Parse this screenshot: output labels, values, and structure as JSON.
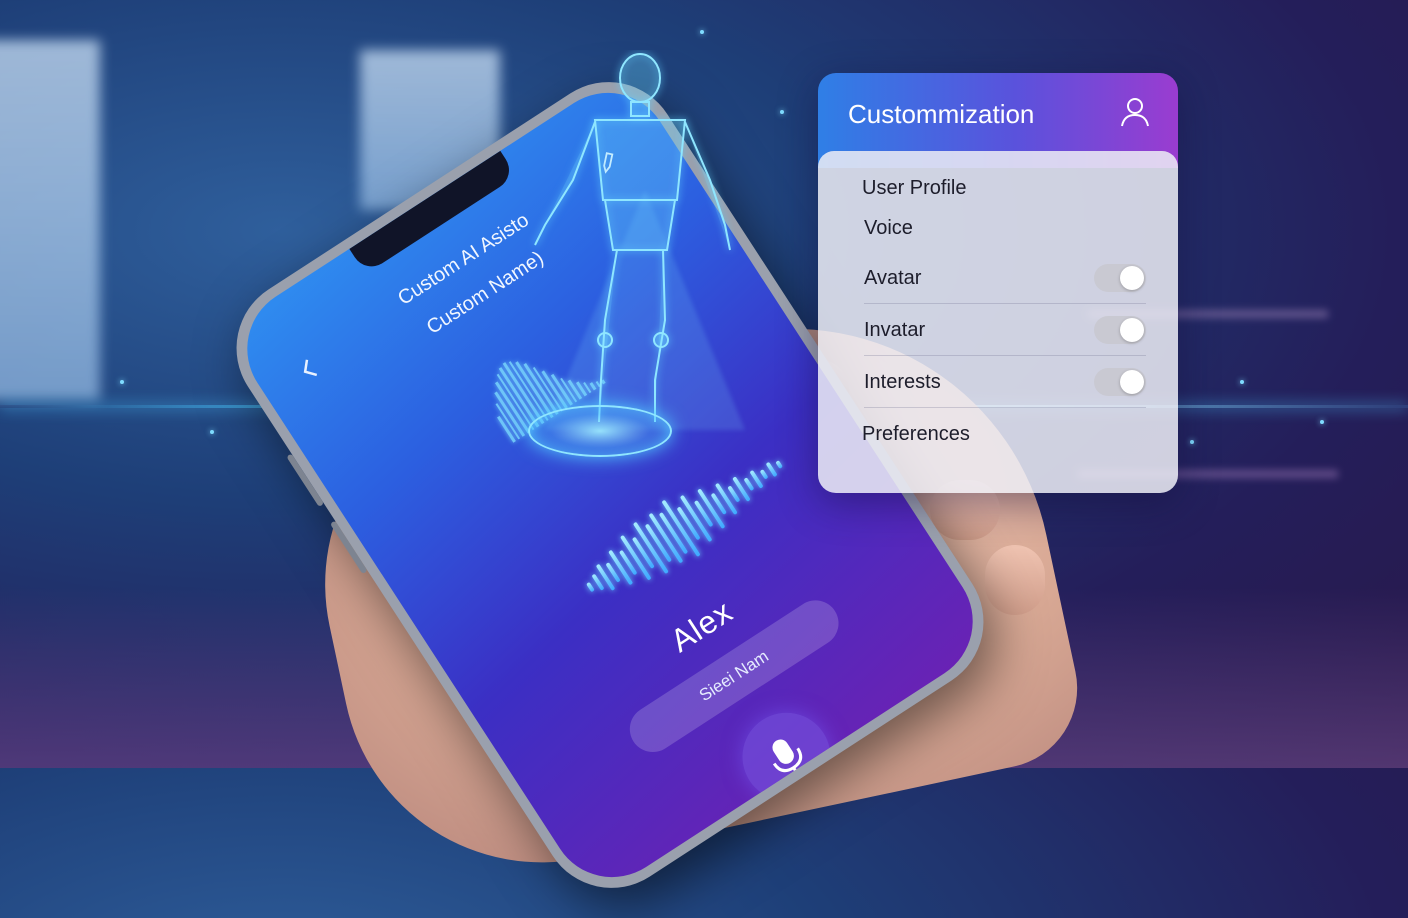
{
  "phone": {
    "back_icon": "chevron-left-icon",
    "title": "Custom AI Asisto",
    "subtitle": "Custom Name)",
    "action_icon": "edit-icon",
    "assistant_name": "Alex",
    "name_field_value": "Sieei Nam",
    "mic_icon": "microphone-icon"
  },
  "panel": {
    "title": "Custommization",
    "user_icon": "user-icon",
    "items": [
      {
        "label": "User Profile"
      },
      {
        "label": "Voice"
      },
      {
        "label": "Avatar",
        "toggle": true
      },
      {
        "label": "Invatar",
        "toggle": true
      },
      {
        "label": "Interests",
        "toggle": true
      },
      {
        "label": "Preferences"
      }
    ]
  },
  "colors": {
    "accent_blue": "#2f7fe6",
    "accent_purple": "#9a3cd0",
    "hologram": "#7fdcff"
  }
}
